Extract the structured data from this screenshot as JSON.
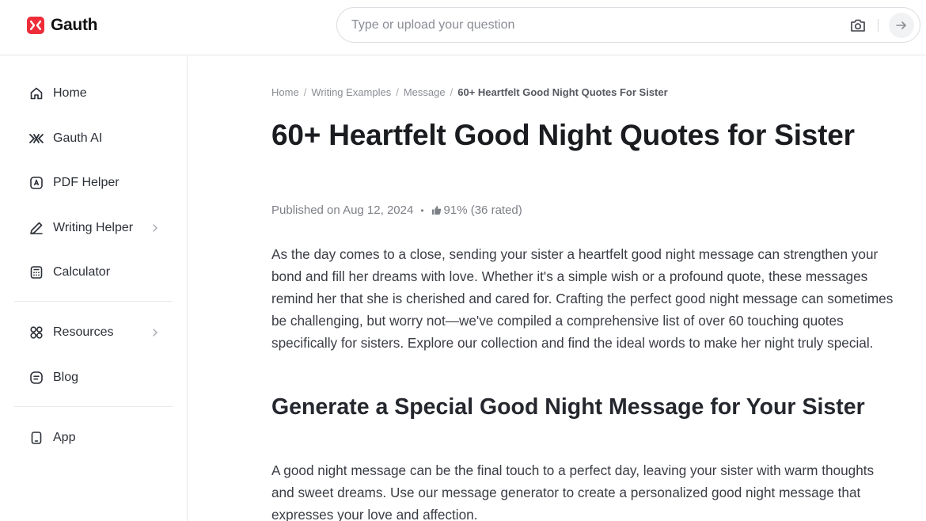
{
  "brand": {
    "name": "Gauth",
    "accent": "#ef2d3a"
  },
  "search": {
    "placeholder": "Type or upload your question",
    "value": ""
  },
  "sidebar": {
    "items": [
      {
        "label": "Home",
        "icon": "home-icon"
      },
      {
        "label": "Gauth AI",
        "icon": "gauth-ai-icon"
      },
      {
        "label": "PDF Helper",
        "icon": "pdf-helper-icon"
      },
      {
        "label": "Writing Helper",
        "icon": "pen-icon",
        "has_submenu": true
      },
      {
        "label": "Calculator",
        "icon": "calculator-icon"
      },
      {
        "label": "Resources",
        "icon": "grid-icon",
        "has_submenu": true
      },
      {
        "label": "Blog",
        "icon": "blog-icon"
      },
      {
        "label": "App",
        "icon": "phone-icon"
      }
    ]
  },
  "breadcrumb": {
    "items": [
      "Home",
      "Writing Examples",
      "Message"
    ],
    "separator": "/",
    "current": "60+ Heartfelt Good Night Quotes For Sister"
  },
  "article": {
    "title": "60+ Heartfelt Good Night Quotes for Sister",
    "published": "Published on Aug 12, 2024",
    "dot": "•",
    "rating": "91% (36 rated)",
    "intro": "As the day comes to a close, sending your sister a heartfelt good night message can strengthen your bond and fill her dreams with love. Whether it's a simple wish or a profound quote, these messages remind her that she is cherished and cared for. Crafting the perfect good night message can sometimes be challenging, but worry not—we've compiled a comprehensive list of over 60 touching quotes specifically for sisters. Explore our collection and find the ideal words to make her night truly special.",
    "section_heading": "Generate a Special Good Night Message for Your Sister",
    "section_paragraph": "A good night message can be the final touch to a perfect day, leaving your sister with warm thoughts and sweet dreams. Use our message generator to create a personalized good night message that expresses your love and affection."
  }
}
